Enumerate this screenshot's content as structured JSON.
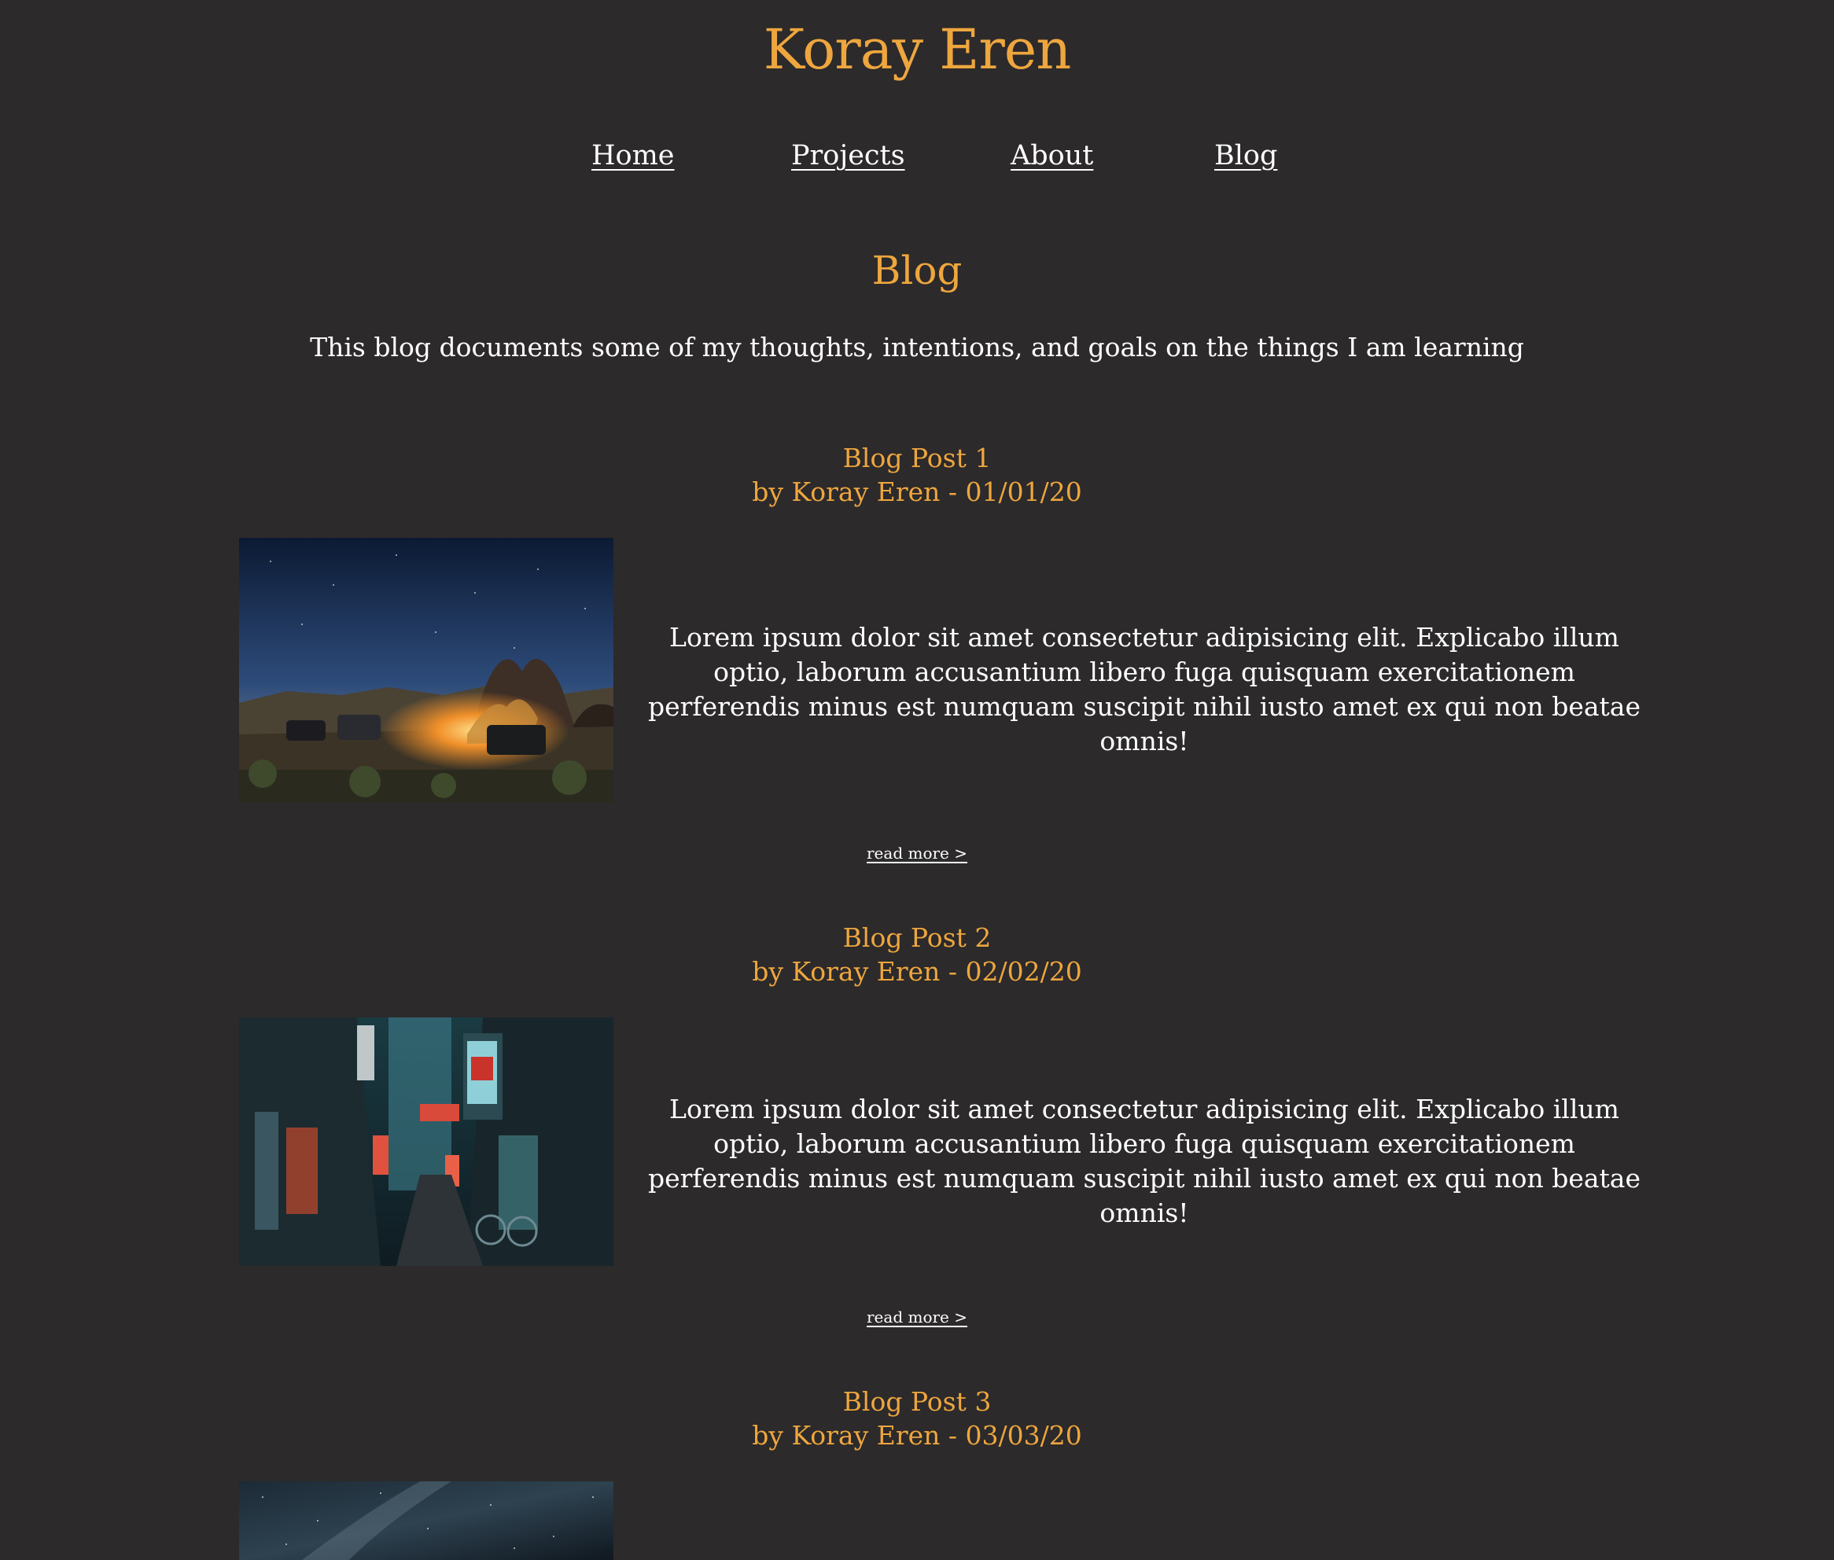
{
  "site": {
    "title": "Koray Eren"
  },
  "nav": {
    "items": [
      {
        "label": "Home"
      },
      {
        "label": "Projects"
      },
      {
        "label": "About"
      },
      {
        "label": "Blog"
      }
    ]
  },
  "blog": {
    "heading": "Blog",
    "intro": "This blog documents some of my thoughts, intentions, and goals on the things I am learning",
    "posts": [
      {
        "title": "Blog Post 1",
        "meta": "by Koray Eren - 01/01/20",
        "body": "Lorem ipsum dolor sit amet consectetur adipisicing elit. Explicabo illum optio, laborum accusantium libero fuga quisquam exercitationem perferendis minus est numquam suscipit nihil iusto amet ex qui non beatae omnis!",
        "read_more": "read more >"
      },
      {
        "title": "Blog Post 2",
        "meta": "by Koray Eren - 02/02/20",
        "body": "Lorem ipsum dolor sit amet consectetur adipisicing elit. Explicabo illum optio, laborum accusantium libero fuga quisquam exercitationem perferendis minus est numquam suscipit nihil iusto amet ex qui non beatae omnis!",
        "read_more": "read more >"
      },
      {
        "title": "Blog Post 3",
        "meta": "by Koray Eren - 03/03/20"
      }
    ]
  },
  "colors": {
    "background": "#2c2a2b",
    "accent": "#eea63e",
    "text": "#ffffff"
  }
}
